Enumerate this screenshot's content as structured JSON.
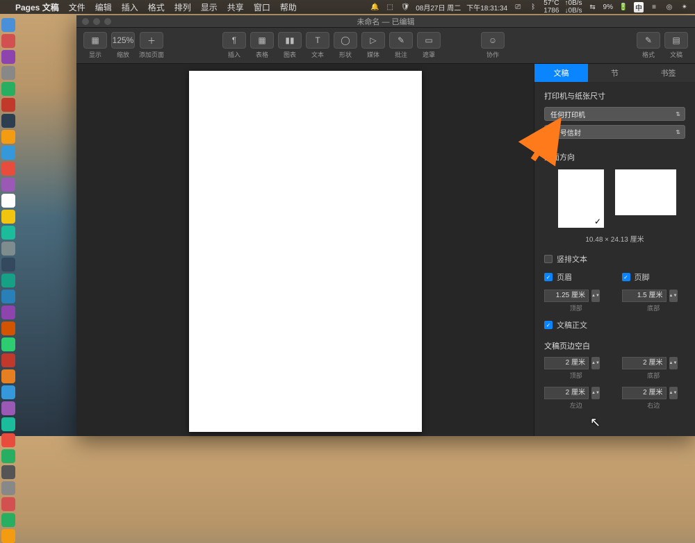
{
  "menubar": {
    "apple": "",
    "app": "Pages 文稿",
    "items": [
      "文件",
      "编辑",
      "插入",
      "格式",
      "排列",
      "显示",
      "共享",
      "窗口",
      "帮助"
    ],
    "right": {
      "date": "08月27日 周二",
      "time": "下午18:31:34",
      "temp": "57°C",
      "fan": "1786",
      "net_down": "↓0B/s",
      "net_up": "↑0B/s",
      "wifi": "",
      "battery_pct": "9%",
      "ime": "中"
    }
  },
  "window": {
    "title": "未命名 — 已编辑",
    "toolbar": {
      "view": "显示",
      "zoom": "缩放",
      "zoom_val": "125%",
      "addpage": "添加页面",
      "insert": "插入",
      "table": "表格",
      "chart": "图表",
      "text": "文本",
      "shape": "形状",
      "media": "媒体",
      "comment": "批注",
      "mask": "遮罩",
      "collaborate": "协作",
      "format": "格式",
      "document": "文稿"
    }
  },
  "inspector": {
    "tabs": {
      "document": "文稿",
      "section": "节",
      "bookmarks": "书签"
    },
    "printer_section": "打印机与纸张尺寸",
    "printer": "任何打印机",
    "paper": "10 号信封",
    "orientation_section": "页面方向",
    "page_dimensions": "10.48 × 24.13 厘米",
    "vertical_text": "竖排文本",
    "header": "页眉",
    "footer": "页脚",
    "header_val": "1.25 厘米",
    "footer_val": "1.5 厘米",
    "top_label": "顶部",
    "bottom_label": "底部",
    "body_text": "文稿正文",
    "margins_section": "文稿页边空白",
    "margin_val": "2 厘米",
    "left_label": "左边",
    "right_label": "右边"
  },
  "dock_colors": [
    "#4a90d9",
    "#d35050",
    "#8e44ad",
    "#888",
    "#27ae60",
    "#c0392b",
    "#2c3e50",
    "#f39c12",
    "#3498db",
    "#e74c3c",
    "#9b59b6",
    "#fff",
    "#f1c40f",
    "#1abc9c",
    "#7f8c8d",
    "#34495e",
    "#16a085",
    "#2980b9",
    "#8e44ad",
    "#d35400",
    "#2ecc71",
    "#c0392b",
    "#e67e22",
    "#3498db",
    "#9b59b6",
    "#1abc9c",
    "#e74c3c",
    "#27ae60",
    "#555",
    "#888",
    "#d35050",
    "#27ae60",
    "#f39c12"
  ]
}
